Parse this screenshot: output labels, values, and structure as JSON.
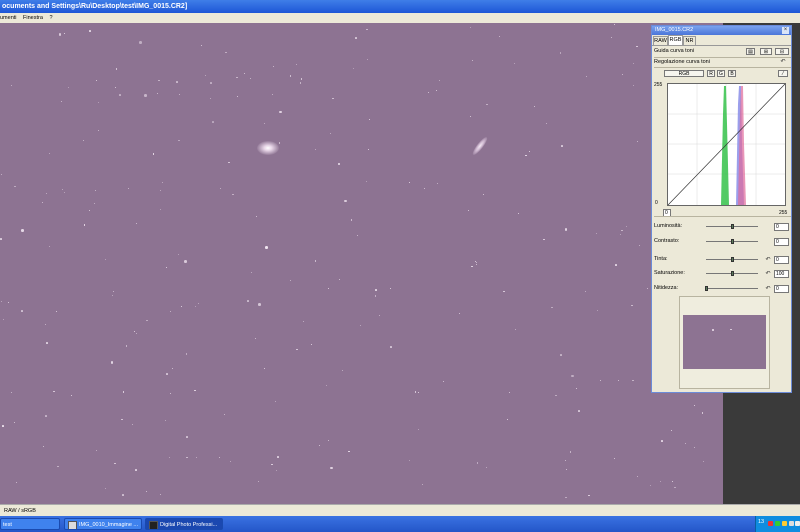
{
  "window": {
    "title": "ocuments and Settings\\Ru\\Desktop\\test\\IMG_0015.CR2]",
    "menu": [
      "umenti",
      "Finestra",
      "?"
    ]
  },
  "palette": {
    "title": "IMG_0015.CR2",
    "tabs": [
      "RAW",
      "RGB",
      "NR"
    ],
    "selected_tab": "RGB",
    "tone_curve_guide": "Guida curva toni",
    "tone_curve_adjust": "Regolazione curva toni",
    "channels": [
      "RGB",
      "R",
      "G",
      "B"
    ],
    "graph_top": "255",
    "graph_bottom": "0",
    "axis_min": "0",
    "axis_max": "255",
    "sliders": [
      {
        "label": "Luminosità:",
        "value": "0",
        "position": 0.5
      },
      {
        "label": "Contrasto:",
        "value": "0",
        "position": 0.5
      },
      {
        "label": "Tinta:",
        "value": "0",
        "position": 0.5
      },
      {
        "label": "Saturazione:",
        "value": "100",
        "position": 0.5
      },
      {
        "label": "Nitidezza:",
        "value": "0",
        "position": 0.0
      }
    ]
  },
  "status": {
    "text": "RAW / sRGB"
  },
  "taskbar": {
    "items": [
      "test",
      "IMG_0010_Immagine ...",
      "Digital Photo Professi..."
    ],
    "clock": "13"
  },
  "colors": {
    "sky": "#8d7392",
    "titlebar": "#1d56d6",
    "panel": "#ece9d8"
  }
}
